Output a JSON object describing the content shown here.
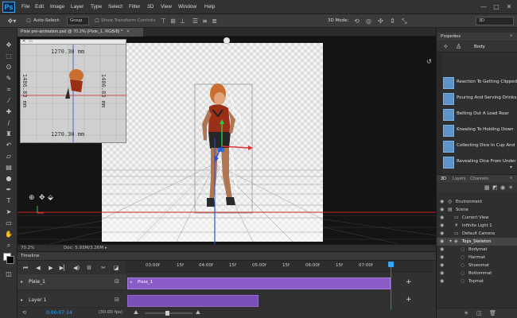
{
  "app": {
    "logo": "Ps"
  },
  "menubar": {
    "items": [
      "File",
      "Edit",
      "Image",
      "Layer",
      "Type",
      "Select",
      "Filter",
      "3D",
      "View",
      "Window",
      "Help"
    ]
  },
  "window_controls": {
    "minimize": "—",
    "maximize": "□",
    "close": "✕"
  },
  "options_bar": {
    "auto_select_label": "Auto-Select:",
    "auto_select_value": "Group",
    "transform_controls_label": "Show Transform Controls",
    "mode_label": "3D Mode:",
    "workspace_value": "3D"
  },
  "document": {
    "tab_title": "Pixie pre-animation.psd @ 70.2% (Pixie_1, RGB/8) *",
    "close": "✕"
  },
  "minimap": {
    "label_top": "1270.30 mm",
    "label_bottom": "1270.30 mm",
    "label_left": "1486.83 mm",
    "label_right": "1486.83 mm"
  },
  "status": {
    "zoom": "70.2%",
    "doc": "Doc: 5.93M/3.26M"
  },
  "timeline": {
    "title": "Timeline",
    "ruler_labels": [
      "03:00f",
      "15f",
      "04:00f",
      "15f",
      "05:00f",
      "15f",
      "06:00f",
      "15f",
      "07:00f"
    ],
    "tracks": [
      {
        "name": "Pixie_1",
        "clip_label": "Pixie_1"
      },
      {
        "name": "Layer 1",
        "clip_label": ""
      }
    ],
    "timecode": "0:00:07:14",
    "fps": "(30.00 fps)"
  },
  "properties": {
    "title": "Properties",
    "type_label": "Body",
    "presets": [
      "Reaction To Getting Clipped",
      "Pouring And Serving Drinks",
      "Belting Out A Load Roar",
      "Kneeling To Holding Down",
      "Collecting Dice In Cup And",
      "Revealing Dice From Under"
    ]
  },
  "layers_panel": {
    "tabs": [
      "3D",
      "Layers",
      "Channels"
    ],
    "rows": [
      {
        "label": "Environment",
        "indent": 0
      },
      {
        "label": "Scene",
        "indent": 0
      },
      {
        "label": "Current View",
        "indent": 1
      },
      {
        "label": "Infinite Light 1",
        "indent": 1
      },
      {
        "label": "Default Camera",
        "indent": 1
      },
      {
        "label": "Tops_Skeleton",
        "indent": 1,
        "selected": true
      },
      {
        "label": "Bodymat",
        "indent": 2
      },
      {
        "label": "Hairmat",
        "indent": 2
      },
      {
        "label": "Shoesmat",
        "indent": 2
      },
      {
        "label": "Bottommat",
        "indent": 2
      },
      {
        "label": "Topmat",
        "indent": 2
      }
    ]
  },
  "colors": {
    "accent": "#31a8ff",
    "clip": "#8a5cc8",
    "playhead": "#e23b3b",
    "panel_bg": "#2f2f2f"
  }
}
